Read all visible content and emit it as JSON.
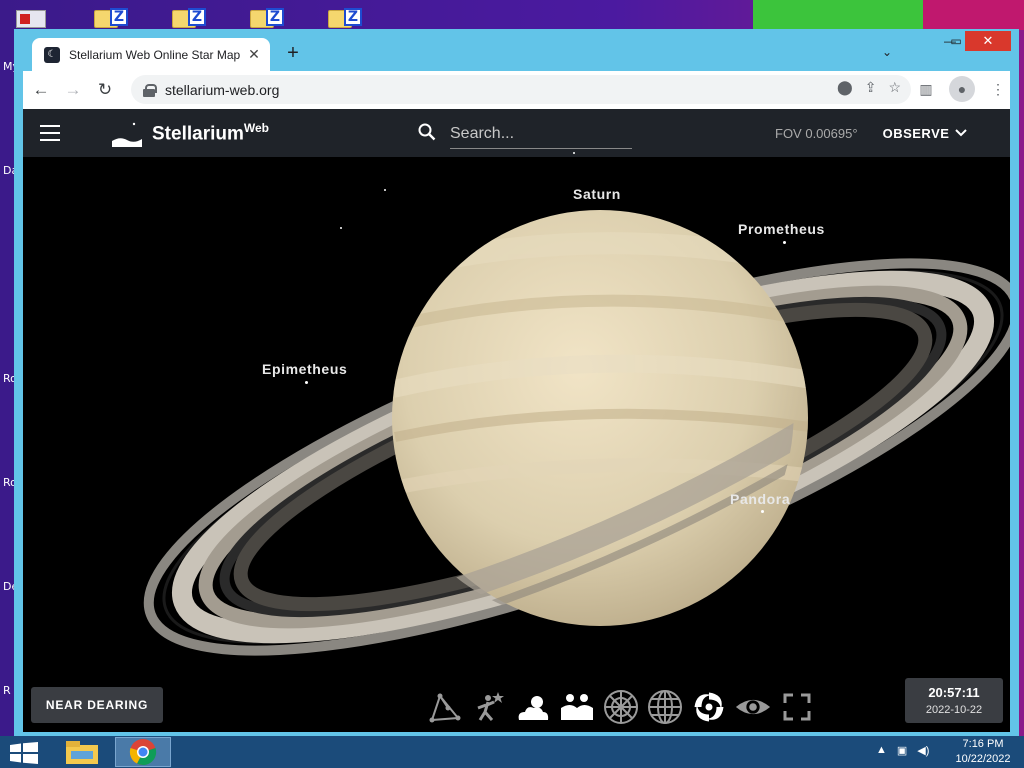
{
  "desktop": {
    "side_labels": [
      "My",
      "Da",
      "Ro",
      "Ro",
      "De",
      "R"
    ]
  },
  "browser": {
    "tab_title": "Stellarium Web Online Star Map",
    "tab_close": "✕",
    "new_tab": "+",
    "url": "stellarium-web.org",
    "window_controls": {
      "minimize": "—",
      "maximize": "▭",
      "close": "✕"
    }
  },
  "app": {
    "brand": "Stellarium",
    "brand_sup": "Web",
    "search": {
      "placeholder": "Search..."
    },
    "fov": "FOV 0.00695°",
    "observe_label": "OBSERVE",
    "location_label": "NEAR DEARING",
    "time": "20:57:11",
    "date": "2022-10-22",
    "objects": {
      "saturn": "Saturn",
      "prometheus": "Prometheus",
      "epimetheus": "Epimetheus",
      "pandora": "Pandora"
    },
    "tools": [
      "constellation-lines-icon",
      "constellation-art-icon",
      "atmosphere-icon",
      "landscape-icon",
      "azimuthal-grid-icon",
      "equatorial-grid-icon",
      "deep-sky-objects-icon",
      "night-mode-icon",
      "fullscreen-icon"
    ]
  },
  "taskbar": {
    "clock_time": "7:16 PM",
    "clock_date": "10/22/2022"
  }
}
